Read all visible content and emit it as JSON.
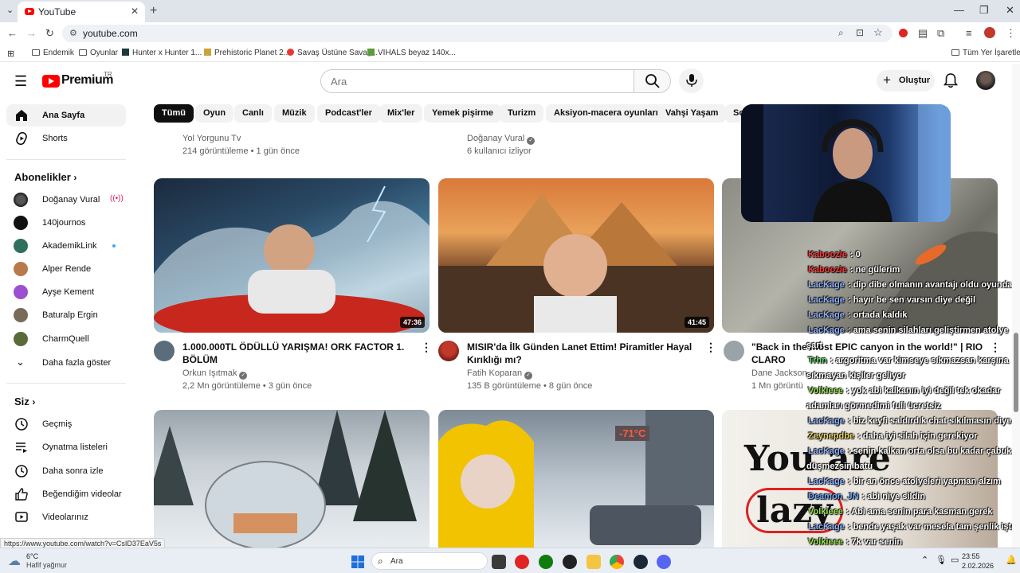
{
  "browser": {
    "tab_title": "YouTube",
    "tab_close": "✕",
    "new_tab": "+",
    "url": "youtube.com",
    "window_controls": [
      "—",
      "❐",
      "✕"
    ],
    "bookmarks": [
      "Endemik",
      "Oyunlar",
      "Hunter x Hunter 1...",
      "Prehistoric Planet 2...",
      "Savaş Üstüne Savaş...",
      "VIHALS beyaz 140x..."
    ],
    "bookmarks_right": "Tüm Yer İşaretleri",
    "status_url": "https://www.youtube.com/watch?v=CsID37EaV5s"
  },
  "masthead": {
    "logo_text": "Premium",
    "logo_region": "TR",
    "search_placeholder": "Ara",
    "create_label": "Oluştur"
  },
  "chips": [
    "Tümü",
    "Oyun",
    "Canlı",
    "Müzik",
    "Podcast'ler",
    "Mix'ler",
    "Yemek pişirme",
    "Turizm",
    "Aksiyon-macera oyunları",
    "Vahşi Yaşam",
    "So"
  ],
  "sidebar": {
    "home": "Ana Sayfa",
    "shorts": "Shorts",
    "subscriptions_header": "Abonelikler",
    "channels": [
      "Doğanay Vural",
      "140journos",
      "AkademikLink",
      "Alper Rende",
      "Ayşe Kement",
      "Baturalp Ergin",
      "CharmQuell"
    ],
    "show_more": "Daha fazla göster",
    "you_header": "Siz",
    "you_items": [
      "Geçmiş",
      "Oynatma listeleri",
      "Daha sonra izle",
      "Beğendiğim videolar",
      "Videolarınız"
    ]
  },
  "top_row": [
    {
      "channel": "Yol Yorgunu Tv",
      "meta": "214 görüntüleme • 1 gün önce"
    },
    {
      "channel": "Doğanay Vural",
      "meta": "6 kullanıcı izliyor"
    }
  ],
  "videos": [
    {
      "title_l1": "1.000.000TL ÖDÜLLÜ YARIŞMA! ORK FACTOR 1.",
      "title_l2": "BÖLÜM",
      "channel": "Orkun Işıtmak",
      "meta": "2,2 Mn görüntüleme • 3 gün önce",
      "duration": "47:36"
    },
    {
      "title_l1": "MISIR'da İlk Günden Lanet Ettim! Piramitler Hayal",
      "title_l2": "Kırıklığı mı?",
      "channel": "Fatih Koparan",
      "meta": "135 B görüntüleme • 8 gün önce",
      "duration": "41:45"
    },
    {
      "title_l1": "\"Back in the most EPIC canyon in the world!\" | RIO",
      "title_l2": "CLARO",
      "channel": "Dane Jackson",
      "meta": "1 Mn görüntü"
    }
  ],
  "thumb_texts": {
    "temp_sign": "-71°C",
    "youre": "You are",
    "lazy": "lazy"
  },
  "chat": [
    {
      "user": "Kaboozie",
      "msg": ": 0",
      "color": "#ff3b3b"
    },
    {
      "user": "Kaboozie",
      "msg": ": ne gülerim",
      "color": "#ff3b3b"
    },
    {
      "user": "LacKage",
      "msg": ": dip dibe olmanın avantajı oldu oyunda",
      "color": "#8fb3ff"
    },
    {
      "user": "LacKage",
      "msg": ": hayır be sen varsın diye değil",
      "color": "#8fb3ff"
    },
    {
      "user": "LacKage",
      "msg": ": ortada kaldık",
      "color": "#8fb3ff"
    },
    {
      "user": "LacKage",
      "msg": ": ama senin silahları geliştirmen atolye",
      "color": "#8fb3ff"
    },
    {
      "user": "",
      "msg": "şart",
      "color": "#ffffff"
    },
    {
      "user": "Trhn",
      "msg": ": argoritma var kimseye sıkmazsan karşına",
      "color": "#6ee07a"
    },
    {
      "user": "",
      "msg": "sıkmayan kişiler geliyor",
      "color": "#ffffff"
    },
    {
      "user": "Volkieee",
      "msg": ": yok abi kalkanın iyi değil tek okadar",
      "color": "#9be35a"
    },
    {
      "user": "",
      "msg": "adamları görmedimi full ücretsiz",
      "color": "#ffffff"
    },
    {
      "user": "LacKage",
      "msg": ": biz keyfi saldırdık chat sıkılmasın diye",
      "color": "#8fb3ff"
    },
    {
      "user": "Zeynepdbe",
      "msg": ": daha iyi silah için gerekiyor",
      "color": "#e9d36a"
    },
    {
      "user": "LacKage",
      "msg": ": senin kalkan orta olsa bu kadar çabuk",
      "color": "#8fb3ff"
    },
    {
      "user": "",
      "msg": "düşmezsin batu",
      "color": "#ffffff"
    },
    {
      "user": "LacKage",
      "msg": ": bir an önce atolyeleri yapman alzım",
      "color": "#8fb3ff"
    },
    {
      "user": "Deamon_JN",
      "msg": ": abi niye sildin",
      "color": "#6aa8ff"
    },
    {
      "user": "Volkieee",
      "msg": ": Abi ama senin para kasman gerek",
      "color": "#9be35a"
    },
    {
      "user": "LacKage",
      "msg": ": bende yaşak var mesela tam şenlik işte",
      "color": "#8fb3ff"
    },
    {
      "user": "Volkieee",
      "msg": ": 7k var senin",
      "color": "#9be35a"
    }
  ],
  "taskbar": {
    "weather_temp": "6°C",
    "weather_desc": "Hafif yağmur",
    "search_label": "Ara",
    "time": "23:55",
    "date": "2.02.2026"
  },
  "colors": {
    "youtube_red": "#ff0000",
    "chip_active": "#0f0f0f"
  }
}
